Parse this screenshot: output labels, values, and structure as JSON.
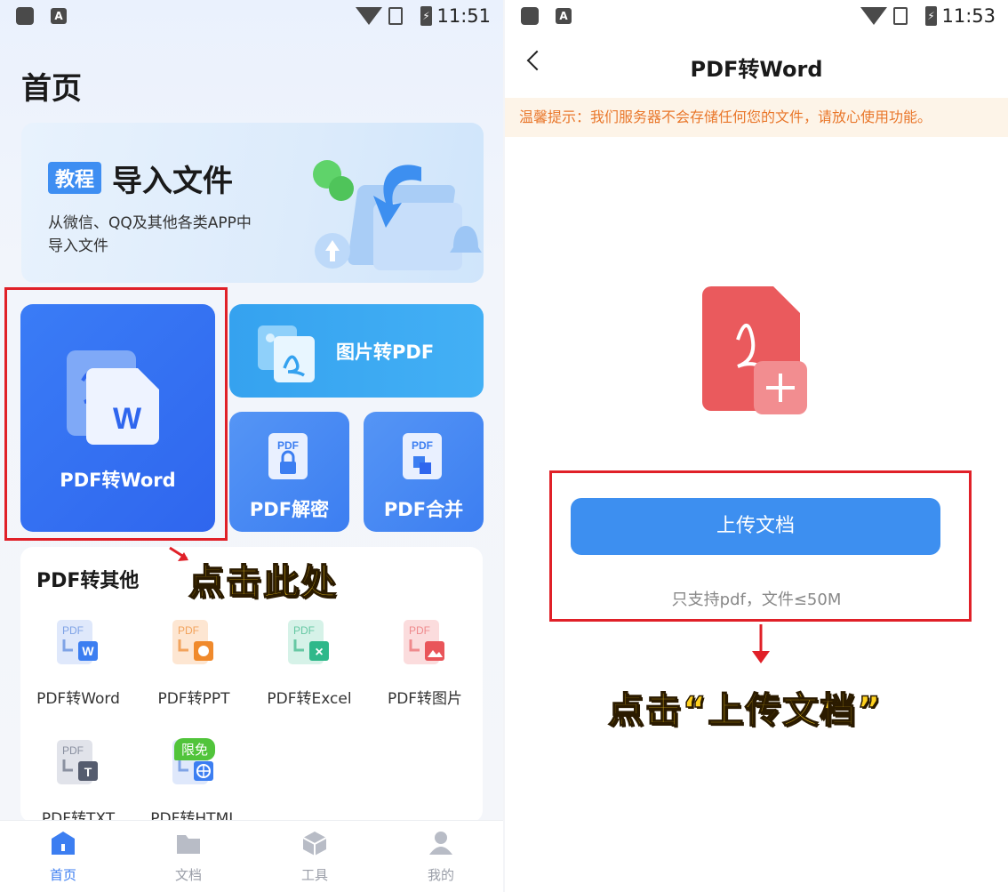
{
  "left": {
    "status": {
      "time": "11:51",
      "icon_a": "A"
    },
    "page_title": "首页",
    "banner": {
      "tag": "教程",
      "title": "导入文件",
      "desc": "从微信、QQ及其他各类APP中导入文件"
    },
    "tiles": {
      "main": "PDF转Word",
      "img2pdf": "图片转PDF",
      "decrypt": "PDF解密",
      "merge": "PDF合并"
    },
    "annotation": "点击此处",
    "section": {
      "title": "PDF转其他",
      "tools": [
        {
          "label": "PDF转Word",
          "icon": "pdf-to-word-icon",
          "color": "#3c7ef1"
        },
        {
          "label": "PDF转PPT",
          "icon": "pdf-to-ppt-icon",
          "color": "#f08a2c"
        },
        {
          "label": "PDF转Excel",
          "icon": "pdf-to-excel-icon",
          "color": "#2fb88a"
        },
        {
          "label": "PDF转图片",
          "icon": "pdf-to-image-icon",
          "color": "#e9555a"
        },
        {
          "label": "PDF转TXT",
          "icon": "pdf-to-txt-icon",
          "color": "#555c6e"
        },
        {
          "label": "PDF转HTML",
          "icon": "pdf-to-html-icon",
          "color": "#3c7ef1"
        }
      ],
      "badge": "限免"
    },
    "nav": [
      {
        "label": "首页",
        "icon": "home-icon"
      },
      {
        "label": "文档",
        "icon": "folder-icon"
      },
      {
        "label": "工具",
        "icon": "toolbox-icon"
      },
      {
        "label": "我的",
        "icon": "profile-icon"
      }
    ],
    "icon_letters": {
      "pdf": "PDF",
      "w": "W",
      "t": "T",
      "x": "×"
    }
  },
  "right": {
    "status": {
      "time": "11:53",
      "icon_a": "A"
    },
    "title": "PDF转Word",
    "notice": "温馨提示：我们服务器不会存储任何您的文件，请放心使用功能。",
    "upload_button": "上传文档",
    "hint": "只支持pdf，文件≤50M",
    "annotation": "点击“上传文档”"
  },
  "colors": {
    "primary": "#3c7ef1",
    "highlight_red": "#e02028",
    "annotation_yellow": "#ffd21f",
    "notice_orange": "#e9772b"
  }
}
